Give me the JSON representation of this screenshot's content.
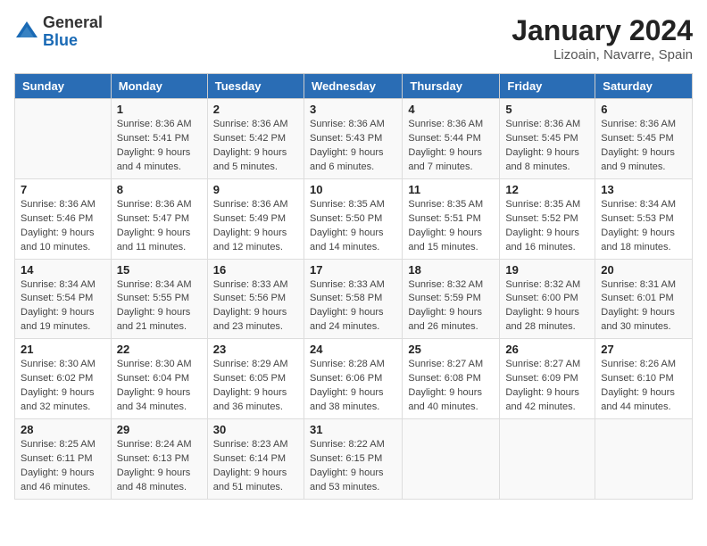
{
  "header": {
    "logo_general": "General",
    "logo_blue": "Blue",
    "month_title": "January 2024",
    "location": "Lizoain, Navarre, Spain"
  },
  "weekdays": [
    "Sunday",
    "Monday",
    "Tuesday",
    "Wednesday",
    "Thursday",
    "Friday",
    "Saturday"
  ],
  "weeks": [
    [
      {
        "day": "",
        "sunrise": "",
        "sunset": "",
        "daylight": ""
      },
      {
        "day": "1",
        "sunrise": "Sunrise: 8:36 AM",
        "sunset": "Sunset: 5:41 PM",
        "daylight": "Daylight: 9 hours and 4 minutes."
      },
      {
        "day": "2",
        "sunrise": "Sunrise: 8:36 AM",
        "sunset": "Sunset: 5:42 PM",
        "daylight": "Daylight: 9 hours and 5 minutes."
      },
      {
        "day": "3",
        "sunrise": "Sunrise: 8:36 AM",
        "sunset": "Sunset: 5:43 PM",
        "daylight": "Daylight: 9 hours and 6 minutes."
      },
      {
        "day": "4",
        "sunrise": "Sunrise: 8:36 AM",
        "sunset": "Sunset: 5:44 PM",
        "daylight": "Daylight: 9 hours and 7 minutes."
      },
      {
        "day": "5",
        "sunrise": "Sunrise: 8:36 AM",
        "sunset": "Sunset: 5:45 PM",
        "daylight": "Daylight: 9 hours and 8 minutes."
      },
      {
        "day": "6",
        "sunrise": "Sunrise: 8:36 AM",
        "sunset": "Sunset: 5:45 PM",
        "daylight": "Daylight: 9 hours and 9 minutes."
      }
    ],
    [
      {
        "day": "7",
        "sunrise": "Sunrise: 8:36 AM",
        "sunset": "Sunset: 5:46 PM",
        "daylight": "Daylight: 9 hours and 10 minutes."
      },
      {
        "day": "8",
        "sunrise": "Sunrise: 8:36 AM",
        "sunset": "Sunset: 5:47 PM",
        "daylight": "Daylight: 9 hours and 11 minutes."
      },
      {
        "day": "9",
        "sunrise": "Sunrise: 8:36 AM",
        "sunset": "Sunset: 5:49 PM",
        "daylight": "Daylight: 9 hours and 12 minutes."
      },
      {
        "day": "10",
        "sunrise": "Sunrise: 8:35 AM",
        "sunset": "Sunset: 5:50 PM",
        "daylight": "Daylight: 9 hours and 14 minutes."
      },
      {
        "day": "11",
        "sunrise": "Sunrise: 8:35 AM",
        "sunset": "Sunset: 5:51 PM",
        "daylight": "Daylight: 9 hours and 15 minutes."
      },
      {
        "day": "12",
        "sunrise": "Sunrise: 8:35 AM",
        "sunset": "Sunset: 5:52 PM",
        "daylight": "Daylight: 9 hours and 16 minutes."
      },
      {
        "day": "13",
        "sunrise": "Sunrise: 8:34 AM",
        "sunset": "Sunset: 5:53 PM",
        "daylight": "Daylight: 9 hours and 18 minutes."
      }
    ],
    [
      {
        "day": "14",
        "sunrise": "Sunrise: 8:34 AM",
        "sunset": "Sunset: 5:54 PM",
        "daylight": "Daylight: 9 hours and 19 minutes."
      },
      {
        "day": "15",
        "sunrise": "Sunrise: 8:34 AM",
        "sunset": "Sunset: 5:55 PM",
        "daylight": "Daylight: 9 hours and 21 minutes."
      },
      {
        "day": "16",
        "sunrise": "Sunrise: 8:33 AM",
        "sunset": "Sunset: 5:56 PM",
        "daylight": "Daylight: 9 hours and 23 minutes."
      },
      {
        "day": "17",
        "sunrise": "Sunrise: 8:33 AM",
        "sunset": "Sunset: 5:58 PM",
        "daylight": "Daylight: 9 hours and 24 minutes."
      },
      {
        "day": "18",
        "sunrise": "Sunrise: 8:32 AM",
        "sunset": "Sunset: 5:59 PM",
        "daylight": "Daylight: 9 hours and 26 minutes."
      },
      {
        "day": "19",
        "sunrise": "Sunrise: 8:32 AM",
        "sunset": "Sunset: 6:00 PM",
        "daylight": "Daylight: 9 hours and 28 minutes."
      },
      {
        "day": "20",
        "sunrise": "Sunrise: 8:31 AM",
        "sunset": "Sunset: 6:01 PM",
        "daylight": "Daylight: 9 hours and 30 minutes."
      }
    ],
    [
      {
        "day": "21",
        "sunrise": "Sunrise: 8:30 AM",
        "sunset": "Sunset: 6:02 PM",
        "daylight": "Daylight: 9 hours and 32 minutes."
      },
      {
        "day": "22",
        "sunrise": "Sunrise: 8:30 AM",
        "sunset": "Sunset: 6:04 PM",
        "daylight": "Daylight: 9 hours and 34 minutes."
      },
      {
        "day": "23",
        "sunrise": "Sunrise: 8:29 AM",
        "sunset": "Sunset: 6:05 PM",
        "daylight": "Daylight: 9 hours and 36 minutes."
      },
      {
        "day": "24",
        "sunrise": "Sunrise: 8:28 AM",
        "sunset": "Sunset: 6:06 PM",
        "daylight": "Daylight: 9 hours and 38 minutes."
      },
      {
        "day": "25",
        "sunrise": "Sunrise: 8:27 AM",
        "sunset": "Sunset: 6:08 PM",
        "daylight": "Daylight: 9 hours and 40 minutes."
      },
      {
        "day": "26",
        "sunrise": "Sunrise: 8:27 AM",
        "sunset": "Sunset: 6:09 PM",
        "daylight": "Daylight: 9 hours and 42 minutes."
      },
      {
        "day": "27",
        "sunrise": "Sunrise: 8:26 AM",
        "sunset": "Sunset: 6:10 PM",
        "daylight": "Daylight: 9 hours and 44 minutes."
      }
    ],
    [
      {
        "day": "28",
        "sunrise": "Sunrise: 8:25 AM",
        "sunset": "Sunset: 6:11 PM",
        "daylight": "Daylight: 9 hours and 46 minutes."
      },
      {
        "day": "29",
        "sunrise": "Sunrise: 8:24 AM",
        "sunset": "Sunset: 6:13 PM",
        "daylight": "Daylight: 9 hours and 48 minutes."
      },
      {
        "day": "30",
        "sunrise": "Sunrise: 8:23 AM",
        "sunset": "Sunset: 6:14 PM",
        "daylight": "Daylight: 9 hours and 51 minutes."
      },
      {
        "day": "31",
        "sunrise": "Sunrise: 8:22 AM",
        "sunset": "Sunset: 6:15 PM",
        "daylight": "Daylight: 9 hours and 53 minutes."
      },
      {
        "day": "",
        "sunrise": "",
        "sunset": "",
        "daylight": ""
      },
      {
        "day": "",
        "sunrise": "",
        "sunset": "",
        "daylight": ""
      },
      {
        "day": "",
        "sunrise": "",
        "sunset": "",
        "daylight": ""
      }
    ]
  ]
}
